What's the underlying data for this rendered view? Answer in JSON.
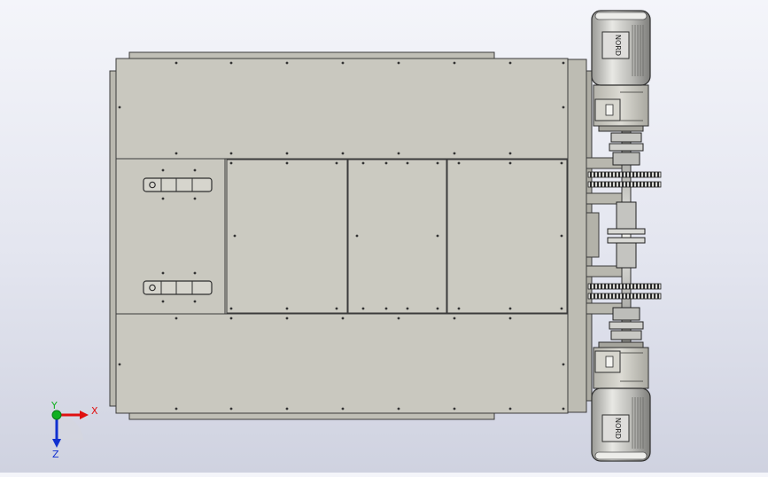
{
  "viewport": {
    "background_top": "#f4f5fa",
    "background_bottom": "#cfd2e0"
  },
  "model": {
    "panel_color": "#c9c8bf",
    "edge_color": "#3b3b3b",
    "motor_badge_top": "NORD",
    "motor_badge_bottom": "NORD"
  },
  "triad": {
    "x_label": "X",
    "y_label": "Y",
    "z_label": "Z",
    "x_color": "#e01010",
    "y_color": "#10b020",
    "z_color": "#1030d0"
  }
}
